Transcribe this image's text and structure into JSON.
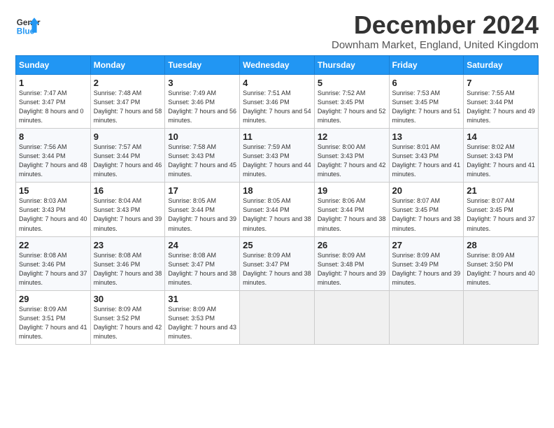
{
  "logo": {
    "line1": "General",
    "line2": "Blue"
  },
  "title": "December 2024",
  "subtitle": "Downham Market, England, United Kingdom",
  "headers": [
    "Sunday",
    "Monday",
    "Tuesday",
    "Wednesday",
    "Thursday",
    "Friday",
    "Saturday"
  ],
  "weeks": [
    [
      {
        "day": "1",
        "sunrise": "7:47 AM",
        "sunset": "3:47 PM",
        "daylight": "8 hours and 0 minutes."
      },
      {
        "day": "2",
        "sunrise": "7:48 AM",
        "sunset": "3:47 PM",
        "daylight": "7 hours and 58 minutes."
      },
      {
        "day": "3",
        "sunrise": "7:49 AM",
        "sunset": "3:46 PM",
        "daylight": "7 hours and 56 minutes."
      },
      {
        "day": "4",
        "sunrise": "7:51 AM",
        "sunset": "3:46 PM",
        "daylight": "7 hours and 54 minutes."
      },
      {
        "day": "5",
        "sunrise": "7:52 AM",
        "sunset": "3:45 PM",
        "daylight": "7 hours and 52 minutes."
      },
      {
        "day": "6",
        "sunrise": "7:53 AM",
        "sunset": "3:45 PM",
        "daylight": "7 hours and 51 minutes."
      },
      {
        "day": "7",
        "sunrise": "7:55 AM",
        "sunset": "3:44 PM",
        "daylight": "7 hours and 49 minutes."
      }
    ],
    [
      {
        "day": "8",
        "sunrise": "7:56 AM",
        "sunset": "3:44 PM",
        "daylight": "7 hours and 48 minutes."
      },
      {
        "day": "9",
        "sunrise": "7:57 AM",
        "sunset": "3:44 PM",
        "daylight": "7 hours and 46 minutes."
      },
      {
        "day": "10",
        "sunrise": "7:58 AM",
        "sunset": "3:43 PM",
        "daylight": "7 hours and 45 minutes."
      },
      {
        "day": "11",
        "sunrise": "7:59 AM",
        "sunset": "3:43 PM",
        "daylight": "7 hours and 44 minutes."
      },
      {
        "day": "12",
        "sunrise": "8:00 AM",
        "sunset": "3:43 PM",
        "daylight": "7 hours and 42 minutes."
      },
      {
        "day": "13",
        "sunrise": "8:01 AM",
        "sunset": "3:43 PM",
        "daylight": "7 hours and 41 minutes."
      },
      {
        "day": "14",
        "sunrise": "8:02 AM",
        "sunset": "3:43 PM",
        "daylight": "7 hours and 41 minutes."
      }
    ],
    [
      {
        "day": "15",
        "sunrise": "8:03 AM",
        "sunset": "3:43 PM",
        "daylight": "7 hours and 40 minutes."
      },
      {
        "day": "16",
        "sunrise": "8:04 AM",
        "sunset": "3:43 PM",
        "daylight": "7 hours and 39 minutes."
      },
      {
        "day": "17",
        "sunrise": "8:05 AM",
        "sunset": "3:44 PM",
        "daylight": "7 hours and 39 minutes."
      },
      {
        "day": "18",
        "sunrise": "8:05 AM",
        "sunset": "3:44 PM",
        "daylight": "7 hours and 38 minutes."
      },
      {
        "day": "19",
        "sunrise": "8:06 AM",
        "sunset": "3:44 PM",
        "daylight": "7 hours and 38 minutes."
      },
      {
        "day": "20",
        "sunrise": "8:07 AM",
        "sunset": "3:45 PM",
        "daylight": "7 hours and 38 minutes."
      },
      {
        "day": "21",
        "sunrise": "8:07 AM",
        "sunset": "3:45 PM",
        "daylight": "7 hours and 37 minutes."
      }
    ],
    [
      {
        "day": "22",
        "sunrise": "8:08 AM",
        "sunset": "3:46 PM",
        "daylight": "7 hours and 37 minutes."
      },
      {
        "day": "23",
        "sunrise": "8:08 AM",
        "sunset": "3:46 PM",
        "daylight": "7 hours and 38 minutes."
      },
      {
        "day": "24",
        "sunrise": "8:08 AM",
        "sunset": "3:47 PM",
        "daylight": "7 hours and 38 minutes."
      },
      {
        "day": "25",
        "sunrise": "8:09 AM",
        "sunset": "3:47 PM",
        "daylight": "7 hours and 38 minutes."
      },
      {
        "day": "26",
        "sunrise": "8:09 AM",
        "sunset": "3:48 PM",
        "daylight": "7 hours and 39 minutes."
      },
      {
        "day": "27",
        "sunrise": "8:09 AM",
        "sunset": "3:49 PM",
        "daylight": "7 hours and 39 minutes."
      },
      {
        "day": "28",
        "sunrise": "8:09 AM",
        "sunset": "3:50 PM",
        "daylight": "7 hours and 40 minutes."
      }
    ],
    [
      {
        "day": "29",
        "sunrise": "8:09 AM",
        "sunset": "3:51 PM",
        "daylight": "7 hours and 41 minutes."
      },
      {
        "day": "30",
        "sunrise": "8:09 AM",
        "sunset": "3:52 PM",
        "daylight": "7 hours and 42 minutes."
      },
      {
        "day": "31",
        "sunrise": "8:09 AM",
        "sunset": "3:53 PM",
        "daylight": "7 hours and 43 minutes."
      },
      null,
      null,
      null,
      null
    ]
  ]
}
